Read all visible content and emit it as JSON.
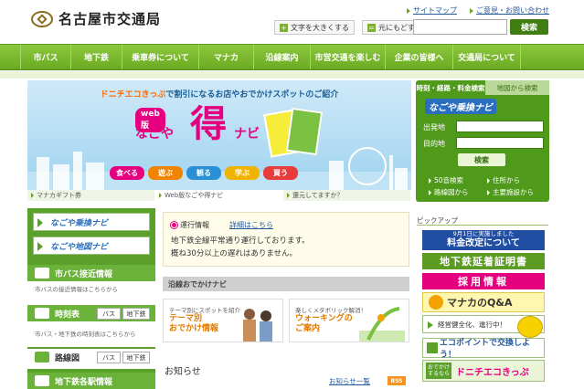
{
  "header": {
    "logo_text": "名古屋市交通局",
    "links": [
      "サイトマップ",
      "ご意見・お問い合わせ"
    ],
    "font_larger": "文字を大きくする",
    "font_reset": "元にもどす",
    "search_button": "検索",
    "search_placeholder": ""
  },
  "nav": {
    "items": [
      "市バス",
      "地下鉄",
      "乗車券について",
      "マナカ",
      "沿線案内",
      "市営交通を楽しむ",
      "企業の皆様へ",
      "交通局について"
    ]
  },
  "banner": {
    "headline_eco": "ドニチエコきっぷ",
    "headline_rest": "で割引になるお店やおでかけスポットのご紹介",
    "web_label": "web版",
    "title_nagoya": "なごや",
    "title_toku": "得",
    "title_navi": "ナビ",
    "categories": [
      {
        "label": "食べる",
        "color": "#e5007f"
      },
      {
        "label": "遊ぶ",
        "color": "#f08300"
      },
      {
        "label": "観る",
        "color": "#2a8fd4"
      },
      {
        "label": "学ぶ",
        "color": "#f0b400"
      },
      {
        "label": "買う",
        "color": "#e83c3c"
      }
    ],
    "tabs": [
      "マナカギフト券",
      "Web版なごや得ナビ",
      "還元してますか？"
    ]
  },
  "route_search": {
    "tab_active": "時刻・経路・料金検索",
    "tab_inactive": "地図から検索",
    "logo": "なごや乗換ナビ",
    "from_label": "出発地",
    "to_label": "目的地",
    "search_button": "検索",
    "links": [
      "50音検索",
      "住所から",
      "路線図から",
      "主要施設から"
    ]
  },
  "left": {
    "banner1": "なごや乗換ナビ",
    "banner2": "なごや地図ナビ",
    "bus_head": "市バス接近情報",
    "bus_sub": "市バスの接近情報はこちらから",
    "timetable_head": "時刻表",
    "timetable_sub": "市バス・地下鉄の時刻表はこちらから",
    "rosen_head": "路線図",
    "btn_bus": "バス",
    "btn_subway": "地下鉄",
    "station_head": "地下鉄各駅情報"
  },
  "status": {
    "label": "運行情報",
    "link": "詳細はこちら",
    "line1": "地下鉄全線平常通り運行しております。",
    "line2": "概ね30分以上の遅れはありません。"
  },
  "ensen": {
    "head": "沿線おでかけナビ",
    "card1_small": "テーマ別にスポットを紹介",
    "card1_title": "テーマ別\nおでかけ情報",
    "card2_small": "楽しくメタボリック解消！",
    "card2_title": "ウォーキングの\nご案内"
  },
  "news": {
    "title": "お知らせ",
    "list_link": "お知らせ一覧",
    "rss": "RSS"
  },
  "pickup": {
    "head": "ピックアップ",
    "b1_small": "9月1日に実施しました",
    "b1_big": "料金改定について",
    "b2": "地下鉄延着証明書",
    "b3": "採用情報",
    "b4": "マナカのQ&A",
    "b5": "経営健全化、進行中！",
    "b6": "エコポイントで交換しよう！",
    "b7_tag": "おでかけするなら",
    "b7": "ドニチエコきっぷ"
  }
}
